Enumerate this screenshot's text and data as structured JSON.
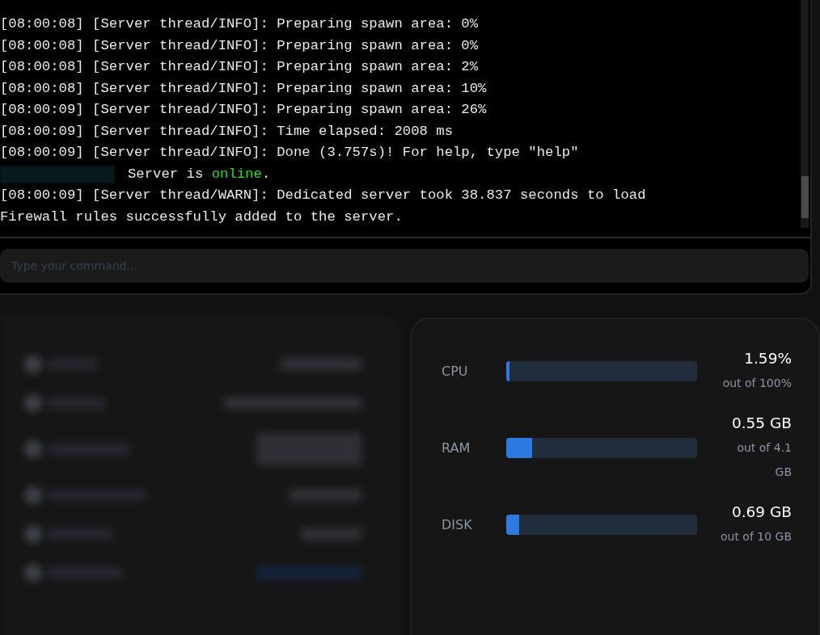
{
  "console": {
    "lines": [
      {
        "kind": "log",
        "text": "[08:00:08] [Server thread/INFO]: Preparing spawn area: 0%"
      },
      {
        "kind": "log",
        "text": "[08:00:08] [Server thread/INFO]: Preparing spawn area: 0%"
      },
      {
        "kind": "log",
        "text": "[08:00:08] [Server thread/INFO]: Preparing spawn area: 2%"
      },
      {
        "kind": "log",
        "text": "[08:00:08] [Server thread/INFO]: Preparing spawn area: 10%"
      },
      {
        "kind": "log",
        "text": "[08:00:09] [Server thread/INFO]: Preparing spawn area: 26%"
      },
      {
        "kind": "log",
        "text": "[08:00:09] [Server thread/INFO]: Time elapsed: 2008 ms"
      },
      {
        "kind": "log",
        "text": "[08:00:09] [Server thread/INFO]: Done (3.757s)! For help, type \"help\""
      },
      {
        "kind": "status",
        "text": "Server is ",
        "highlight": "online",
        "after": "."
      },
      {
        "kind": "log",
        "text": "[08:00:09] [Server thread/WARN]: Dedicated server took 38.837 seconds to load"
      },
      {
        "kind": "log",
        "text": "Firewall rules successfully added to the server."
      }
    ],
    "command": {
      "placeholder": "Type your command..."
    }
  },
  "resources": [
    {
      "label": "CPU",
      "level": 0.016,
      "value": "1.59%",
      "total": "out of 100%"
    },
    {
      "label": "RAM",
      "level": 0.134,
      "value": "0.55 GB",
      "total": "out of 4.1 GB"
    },
    {
      "label": "DISK",
      "level": 0.069,
      "value": "0.69 GB",
      "total": "out of 10 GB"
    }
  ]
}
